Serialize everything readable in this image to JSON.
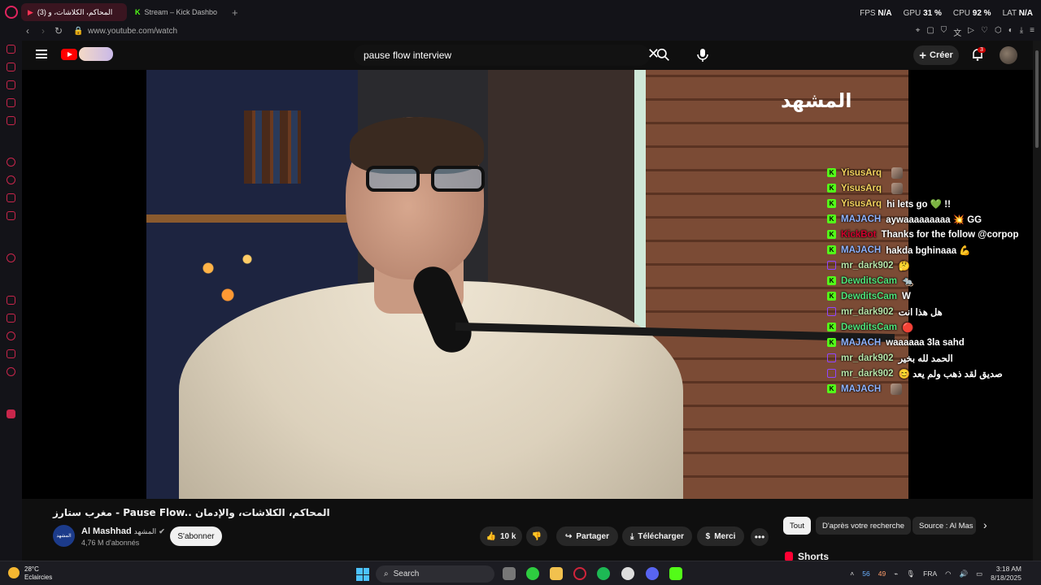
{
  "browser": {
    "tabs": [
      {
        "label": "(3) المحاكم، الكلاشات، و",
        "icon": "youtube-icon",
        "active": true
      },
      {
        "label": "Stream – Kick Dashbo",
        "icon": "kick-icon",
        "active": false
      }
    ],
    "new_tab": "+",
    "stats": {
      "fps_label": "FPS",
      "fps": "N/A",
      "gpu_label": "GPU",
      "gpu": "31 %",
      "cpu_label": "CPU",
      "cpu": "92 %",
      "lat_label": "LAT",
      "lat": "N/A"
    },
    "url": "www.youtube.com/watch"
  },
  "youtube": {
    "search_value": "pause flow interview",
    "create_label": "Créer",
    "notif_count": "3"
  },
  "video": {
    "watermark": "المشهد",
    "title": "مغرب ستارز - Pause Flow.. المحاكم، الكلاشات، والإدمان",
    "channel_name": "Al Mashhad",
    "channel_arabic": "المشهد",
    "channel_avatar_text": "المشهد",
    "subscribers": "4,76 M d'abonnés",
    "subscribe_label": "S'abonner",
    "likes": "10 k",
    "share_label": "Partager",
    "download_label": "Télécharger",
    "thanks_label": "Merci",
    "more_label": "•••"
  },
  "chat": [
    {
      "badge": "kick",
      "user": "YisusArq",
      "color": "#f4d35e",
      "msg": ""
    },
    {
      "badge": "kick",
      "user": "YisusArq",
      "color": "#f4d35e",
      "msg": ""
    },
    {
      "badge": "kick",
      "user": "YisusArq",
      "color": "#f4d35e",
      "msg": "hi lets go 💚 !!"
    },
    {
      "badge": "kick",
      "user": "MAJACH",
      "color": "#8fb4ff",
      "msg": "aywaaaaaaaaa 💥 GG"
    },
    {
      "badge": "kick",
      "user": "KickBot",
      "color": "#d2002d",
      "msg": "Thanks for the follow @corpop"
    },
    {
      "badge": "kick",
      "user": "MAJACH",
      "color": "#8fb4ff",
      "msg": "hakda bghinaaa 💪"
    },
    {
      "badge": "twitch",
      "user": "mr_dark902",
      "color": "#b7e4a8",
      "msg": "🤔"
    },
    {
      "badge": "kick",
      "user": "DewditsCam",
      "color": "#4fe37a",
      "msg": "🐀"
    },
    {
      "badge": "kick",
      "user": "DewditsCam",
      "color": "#4fe37a",
      "msg": "W"
    },
    {
      "badge": "twitch",
      "user": "mr_dark902",
      "color": "#b7e4a8",
      "msg": "هل هذا انت"
    },
    {
      "badge": "kick",
      "user": "DewditsCam",
      "color": "#4fe37a",
      "msg": "🔴"
    },
    {
      "badge": "kick",
      "user": "MAJACH",
      "color": "#8fb4ff",
      "msg": "waaaaaa 3la sahd"
    },
    {
      "badge": "twitch",
      "user": "mr_dark902",
      "color": "#b7e4a8",
      "msg": "الحمد لله بخير"
    },
    {
      "badge": "twitch",
      "user": "mr_dark902",
      "color": "#b7e4a8",
      "msg": "😊 صديق لقد ذهب ولم يعد"
    },
    {
      "badge": "kick",
      "user": "MAJACH",
      "color": "#8fb4ff",
      "msg": ""
    }
  ],
  "chips": [
    "Tout",
    "D'après votre recherche",
    "Source : Al Mas"
  ],
  "shorts_label": "Shorts",
  "taskbar": {
    "temp": "28°C",
    "weather": "Eclaircies",
    "search_label": "Search",
    "tray_a": "56",
    "tray_b": "49",
    "lang": "FRA",
    "time": "3:18 AM",
    "date": "8/18/2025"
  }
}
